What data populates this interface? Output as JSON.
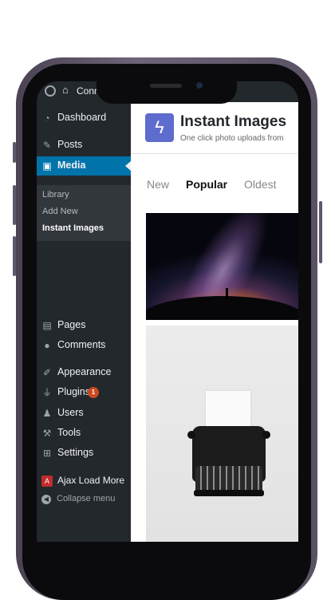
{
  "admin_bar": {
    "site_name": "Conn"
  },
  "sidebar": {
    "items": [
      {
        "label": "Dashboard",
        "icon": "dashboard-icon"
      },
      {
        "label": "Posts",
        "icon": "pin-icon"
      },
      {
        "label": "Media",
        "icon": "media-icon",
        "active": true
      },
      {
        "label": "Pages",
        "icon": "pages-icon"
      },
      {
        "label": "Comments",
        "icon": "comments-icon"
      },
      {
        "label": "Appearance",
        "icon": "brush-icon"
      },
      {
        "label": "Plugins",
        "icon": "plugin-icon",
        "badge": "1"
      },
      {
        "label": "Users",
        "icon": "user-icon"
      },
      {
        "label": "Tools",
        "icon": "wrench-icon"
      },
      {
        "label": "Settings",
        "icon": "settings-icon"
      },
      {
        "label": "Ajax Load More",
        "icon": "ajax-load-more-icon"
      }
    ],
    "submenu": [
      "Library",
      "Add New",
      "Instant Images"
    ],
    "collapse_label": "Collapse menu"
  },
  "plugin": {
    "title": "Instant Images",
    "subtitle": "One click photo uploads from"
  },
  "tabs": [
    "New",
    "Popular",
    "Oldest"
  ],
  "colors": {
    "menu_active": "#0073aa",
    "plugin_accent": "#5d6ccd",
    "badge": "#ca4a1f"
  }
}
